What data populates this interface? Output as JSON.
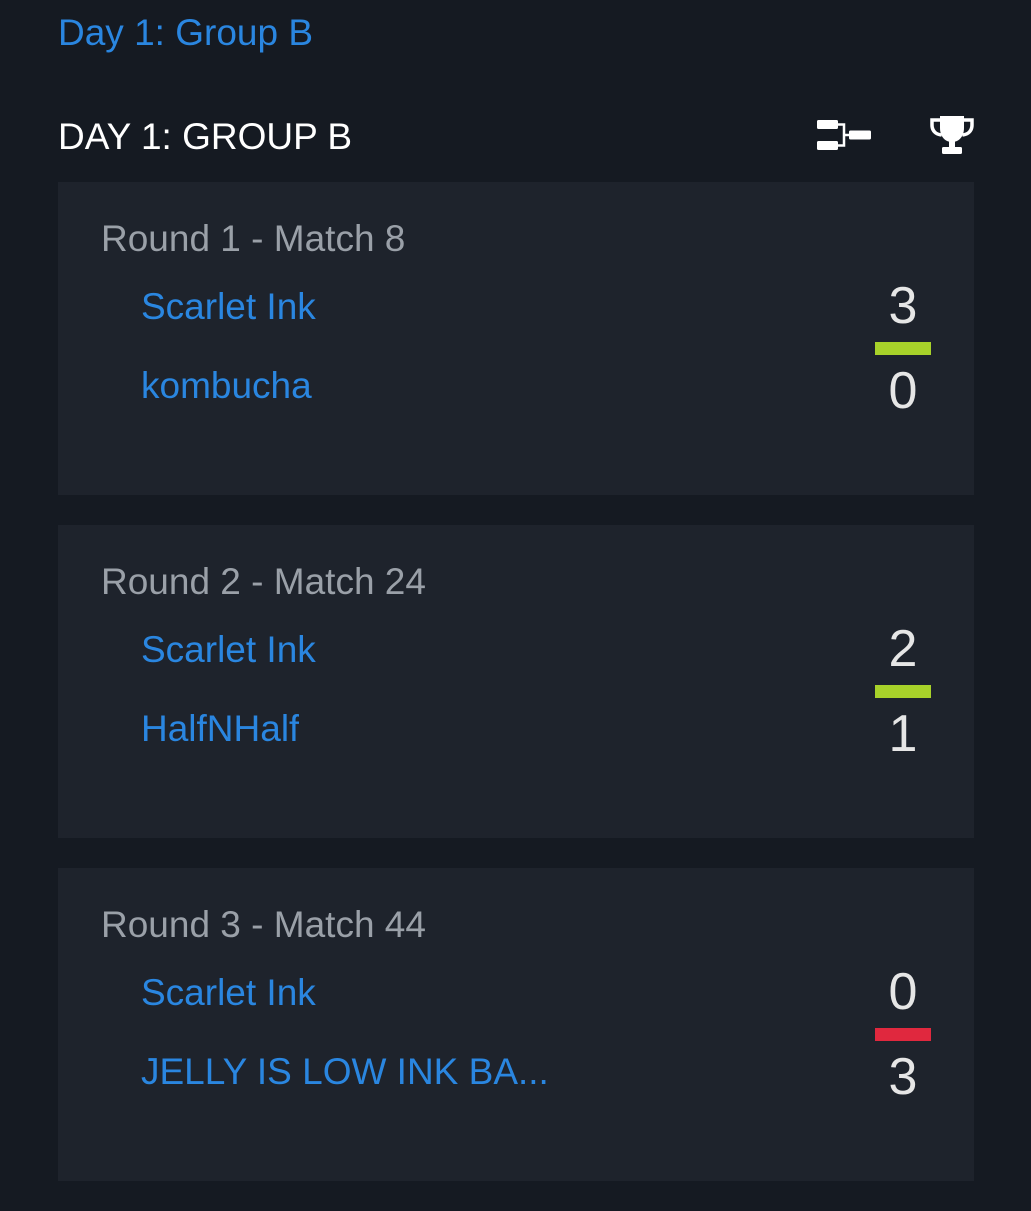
{
  "breadcrumb": "Day 1: Group B",
  "section": {
    "title": "DAY 1: GROUP B",
    "icons": {
      "bracket": "bracket-icon",
      "trophy": "trophy-icon"
    }
  },
  "colors": {
    "win": "#a8d22a",
    "loss": "#e0283e",
    "link": "#2a86e0",
    "background": "#151a22",
    "card": "#1e232c"
  },
  "matches": [
    {
      "round_label": "Round 1 - Match 8",
      "team1": "Scarlet Ink",
      "team2": "kombucha",
      "score1": "3",
      "score2": "0",
      "result": "win"
    },
    {
      "round_label": "Round 2 - Match 24",
      "team1": "Scarlet Ink",
      "team2": "HalfNHalf",
      "score1": "2",
      "score2": "1",
      "result": "win"
    },
    {
      "round_label": "Round 3 - Match 44",
      "team1": "Scarlet Ink",
      "team2": "JELLY IS LOW INK BA...",
      "score1": "0",
      "score2": "3",
      "result": "loss"
    }
  ]
}
